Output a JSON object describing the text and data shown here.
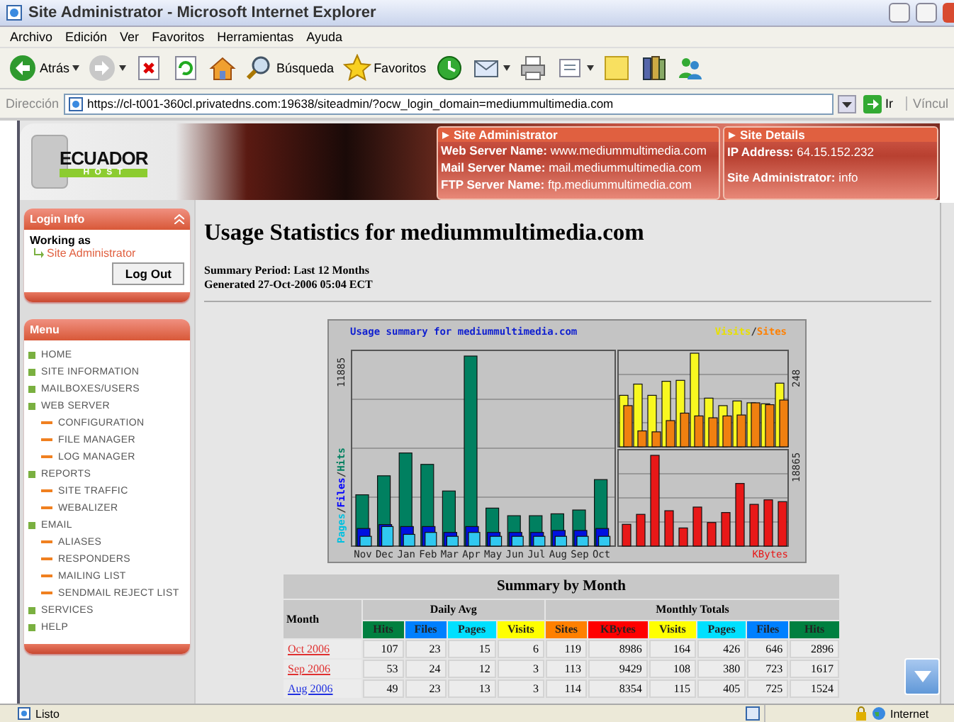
{
  "window": {
    "title": "Site Administrator - Microsoft Internet Explorer"
  },
  "menu_bar": [
    "Archivo",
    "Edición",
    "Ver",
    "Favoritos",
    "Herramientas",
    "Ayuda"
  ],
  "toolbar": [
    {
      "kind": "back",
      "label": "Atrás",
      "dropdown": true
    },
    {
      "kind": "forward",
      "dropdown": true
    },
    {
      "kind": "stop"
    },
    {
      "kind": "refresh"
    },
    {
      "kind": "home"
    },
    {
      "kind": "search",
      "label": "Búsqueda"
    },
    {
      "kind": "favorites",
      "label": "Favoritos"
    },
    {
      "kind": "history"
    },
    {
      "kind": "mail",
      "dropdown": true
    },
    {
      "kind": "print"
    },
    {
      "kind": "edit",
      "dropdown": true
    },
    {
      "kind": "notes"
    },
    {
      "kind": "research"
    },
    {
      "kind": "messenger"
    }
  ],
  "address_bar": {
    "label": "Dirección",
    "url": "https://cl-t001-360cl.privatedns.com:19638/siteadmin/?ocw_login_domain=mediummultimedia.com",
    "go": "Ir",
    "links": "Víncul"
  },
  "header": {
    "logo": {
      "main": "ECUADOR",
      "sub": "H O S T"
    },
    "panels": [
      {
        "title": "Site Administrator",
        "fields": [
          {
            "label": "Web Server Name:",
            "value": "www.mediummultimedia.com"
          },
          {
            "label": "Mail Server Name:",
            "value": "mail.mediummultimedia.com"
          },
          {
            "label": "FTP Server Name:",
            "value": "ftp.mediummultimedia.com"
          }
        ]
      },
      {
        "title": "Site Details",
        "fields": [
          {
            "label": "IP Address:",
            "value": "64.15.152.232"
          },
          {
            "label": "Site Administrator:",
            "value": "info"
          }
        ]
      }
    ]
  },
  "login_info": {
    "title": "Login Info",
    "working_as": "Working as",
    "user": "Site Administrator",
    "logout": "Log Out"
  },
  "menu": {
    "title": "Menu",
    "items": [
      {
        "label": "HOME"
      },
      {
        "label": "SITE INFORMATION"
      },
      {
        "label": "MAILBOXES/USERS"
      },
      {
        "label": "WEB SERVER",
        "children": [
          {
            "label": "CONFIGURATION"
          },
          {
            "label": "FILE MANAGER"
          },
          {
            "label": "LOG MANAGER"
          }
        ]
      },
      {
        "label": "REPORTS",
        "children": [
          {
            "label": "SITE TRAFFIC"
          },
          {
            "label": "WEBALIZER"
          }
        ]
      },
      {
        "label": "EMAIL",
        "children": [
          {
            "label": "ALIASES"
          },
          {
            "label": "RESPONDERS"
          },
          {
            "label": "MAILING LIST"
          },
          {
            "label": "SENDMAIL REJECT LIST"
          }
        ]
      },
      {
        "label": "SERVICES"
      },
      {
        "label": "HELP"
      }
    ]
  },
  "report": {
    "title": "Usage Statistics for mediummultimedia.com",
    "period": "Summary Period: Last 12 Months",
    "generated": "Generated 27-Oct-2006 05:04 ECT"
  },
  "chart": {
    "title": "Usage summary for mediummultimedia.com",
    "legend": [
      {
        "text": "Visits",
        "color": "#e8e000"
      },
      {
        "text": "Sites",
        "color": "#ff8000"
      }
    ],
    "y_label": [
      {
        "text": "Pages",
        "color": "#00c0e0"
      },
      {
        "text": "Files",
        "color": "#0000ff"
      },
      {
        "text": "Hits",
        "color": "#008060"
      }
    ],
    "separator": "/",
    "hits_max": "11885",
    "visits_max": "248",
    "kbytes_max": "18865",
    "kbytes_label": "KBytes",
    "months": [
      "Nov",
      "Dec",
      "Jan",
      "Feb",
      "Mar",
      "Apr",
      "May",
      "Jun",
      "Jul",
      "Aug",
      "Sep",
      "Oct"
    ]
  },
  "summary_table": {
    "title": "Summary by Month",
    "month_heading": "Month",
    "groups": [
      "Daily Avg",
      "Monthly Totals"
    ],
    "columns": [
      {
        "label": "Hits",
        "color": "#008040"
      },
      {
        "label": "Files",
        "color": "#0080ff"
      },
      {
        "label": "Pages",
        "color": "#00e0ff"
      },
      {
        "label": "Visits",
        "color": "#ffff00"
      },
      {
        "label": "Sites",
        "color": "#ff8000"
      },
      {
        "label": "KBytes",
        "color": "#ff0000"
      },
      {
        "label": "Visits",
        "color": "#ffff00"
      },
      {
        "label": "Pages",
        "color": "#00e0ff"
      },
      {
        "label": "Files",
        "color": "#0080ff"
      },
      {
        "label": "Hits",
        "color": "#008040"
      }
    ],
    "rows": [
      {
        "month": "Oct 2006",
        "visited": true,
        "values": [
          "107",
          "23",
          "15",
          "6",
          "119",
          "8986",
          "164",
          "426",
          "646",
          "2896"
        ]
      },
      {
        "month": "Sep 2006",
        "visited": true,
        "values": [
          "53",
          "24",
          "12",
          "3",
          "113",
          "9429",
          "108",
          "380",
          "723",
          "1617"
        ]
      },
      {
        "month": "Aug 2006",
        "visited": false,
        "values": [
          "49",
          "23",
          "13",
          "3",
          "114",
          "8354",
          "115",
          "405",
          "725",
          "1524"
        ]
      }
    ]
  },
  "status_bar": {
    "text": "Listo",
    "zone": "Internet"
  }
}
